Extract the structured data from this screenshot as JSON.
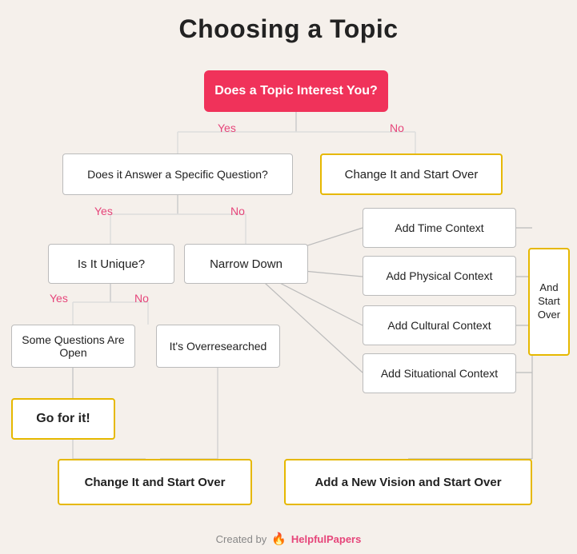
{
  "title": "Choosing a Topic",
  "boxes": {
    "does_topic": "Does a Topic Interest You?",
    "does_answer": "Does it Answer a Specific Question?",
    "is_unique": "Is It Unique?",
    "narrow_down": "Narrow Down",
    "some_questions": "Some Questions Are Open",
    "overresearched": "It's Overresearched",
    "go_for_it": "Go for it!",
    "change_start1": "Change It and Start Over",
    "change_start2": "Change It and Start Over",
    "add_new_vision": "Add a New Vision and Start Over",
    "add_time": "Add Time Context",
    "add_physical": "Add Physical Context",
    "add_cultural": "Add Cultural Context",
    "add_situational": "Add Situational Context",
    "and_start_over": "And Start Over"
  },
  "labels": {
    "yes": "Yes",
    "no": "No"
  },
  "footer": {
    "created_by": "Created by",
    "brand": "HelpfulPapers"
  }
}
